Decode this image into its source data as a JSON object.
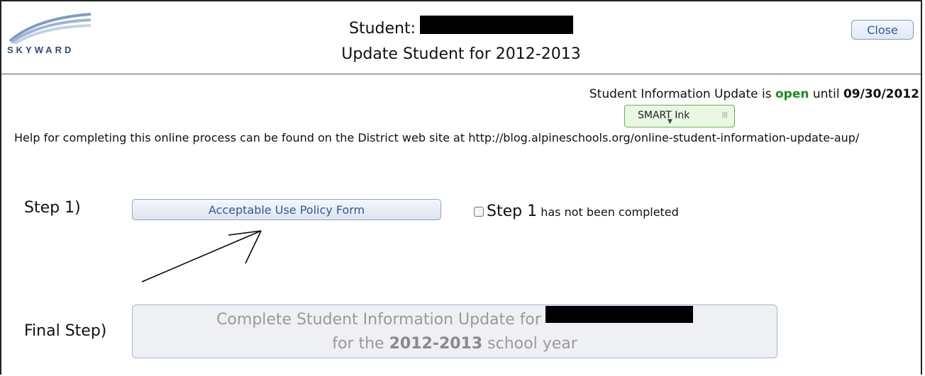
{
  "header": {
    "logo_text": "SKYWARD",
    "title_prefix": "Student:",
    "subtitle": "Update Student for 2012-2013",
    "close_label": "Close"
  },
  "status": {
    "prefix": "Student Information Update is",
    "state": "open",
    "until": "until",
    "date": "09/30/2012"
  },
  "smart_ink": {
    "label": "SMART Ink"
  },
  "help_text": "Help for completing this online process can be found on the District web site at http://blog.alpineschools.org/online-student-information-update-aup/",
  "step1": {
    "label": "Step 1)",
    "button_label": "Acceptable Use Policy Form",
    "status_big": "Step 1",
    "status_rest": "has not been completed"
  },
  "final_step": {
    "label": "Final Step)",
    "line1": "Complete Student Information Update for",
    "line2_prefix": "for the",
    "year": "2012-2013",
    "line2_suffix": "school year"
  },
  "colors": {
    "open": "#1e8a1e",
    "link_blue": "#2c5aa0",
    "smart_ink_green": "#6ab04c"
  }
}
